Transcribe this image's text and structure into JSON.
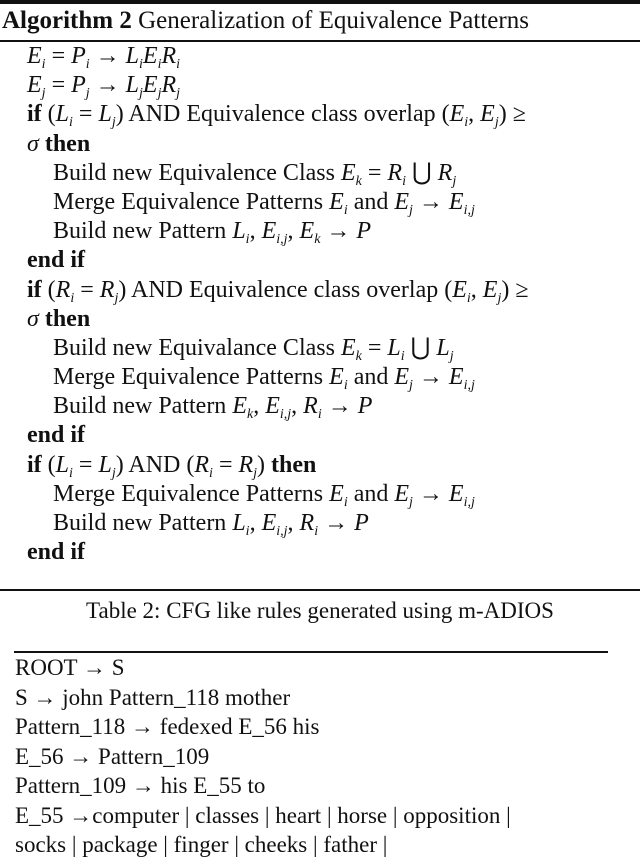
{
  "algorithm": {
    "label": "Algorithm 2",
    "title": "Generalization of Equivalence Patterns",
    "lines": [
      {
        "indent": false,
        "html": "<span class='m'>E<sub>i</sub></span> = <span class='m'>P<sub>i</sub></span> → <span class='m'>L<sub>i</sub>E<sub>i</sub>R<sub>i</sub></span>"
      },
      {
        "indent": false,
        "html": "<span class='m'>E<sub>j</sub></span> = <span class='m'>P<sub>j</sub></span> → <span class='m'>L<sub>j</sub>E<sub>j</sub>R<sub>j</sub></span>"
      },
      {
        "indent": false,
        "html": "<span class='kw'>if</span> (<span class='m'>L<sub>i</sub></span> = <span class='m'>L<sub>j</sub></span>) AND Equivalence class overlap (<span class='m'>E<sub>i</sub></span>, <span class='m'>E<sub>j</sub></span>) ≥"
      },
      {
        "indent": false,
        "html": "<span class='m'>σ</span> <span class='kw'>then</span>"
      },
      {
        "indent": true,
        "html": "Build new Equivalence Class <span class='m'>E<sub>k</sub></span> = <span class='m'>R<sub>i</sub></span> ⋃ <span class='m'>R<sub>j</sub></span>"
      },
      {
        "indent": true,
        "html": "Merge Equivalence Patterns <span class='m'>E<sub>i</sub></span> and <span class='m'>E<sub>j</sub></span> → <span class='m'>E<sub>i,j</sub></span>"
      },
      {
        "indent": true,
        "html": "Build new Pattern <span class='m'>L<sub>i</sub></span>, <span class='m'>E<sub>i,j</sub></span>, <span class='m'>E<sub>k</sub></span> → <span class='m'>P</span>"
      },
      {
        "indent": false,
        "html": "<span class='kw'>end if</span>"
      },
      {
        "indent": false,
        "html": "<span class='kw'>if</span> (<span class='m'>R<sub>i</sub></span> = <span class='m'>R<sub>j</sub></span>) AND Equivalence class overlap (<span class='m'>E<sub>i</sub></span>, <span class='m'>E<sub>j</sub></span>) ≥"
      },
      {
        "indent": false,
        "html": "<span class='m'>σ</span> <span class='kw'>then</span>"
      },
      {
        "indent": true,
        "html": "Build new Equivalance Class <span class='m'>E<sub>k</sub></span> = <span class='m'>L<sub>i</sub></span> ⋃ <span class='m'>L<sub>j</sub></span>"
      },
      {
        "indent": true,
        "html": "Merge Equivalence Patterns <span class='m'>E<sub>i</sub></span> and <span class='m'>E<sub>j</sub></span> → <span class='m'>E<sub>i,j</sub></span>"
      },
      {
        "indent": true,
        "html": "Build new Pattern <span class='m'>E<sub>k</sub></span>, <span class='m'>E<sub>i,j</sub></span>, <span class='m'>R<sub>i</sub></span> → <span class='m'>P</span>"
      },
      {
        "indent": false,
        "html": "<span class='kw'>end if</span>"
      },
      {
        "indent": false,
        "html": "<span class='kw'>if</span> (<span class='m'>L<sub>i</sub></span> = <span class='m'>L<sub>j</sub></span>) AND (<span class='m'>R<sub>i</sub></span> = <span class='m'>R<sub>j</sub></span>) <span class='kw'>then</span>"
      },
      {
        "indent": true,
        "html": "Merge Equivalence Patterns <span class='m'>E<sub>i</sub></span> and <span class='m'>E<sub>j</sub></span> → <span class='m'>E<sub>i,j</sub></span>"
      },
      {
        "indent": true,
        "html": "Build new Pattern <span class='m'>L<sub>i</sub></span>, <span class='m'>E<sub>i,j</sub></span>, <span class='m'>R<sub>i</sub></span> → <span class='m'>P</span>"
      },
      {
        "indent": false,
        "html": "<span class='kw'>end if</span>"
      }
    ]
  },
  "table": {
    "caption": "Table 2: CFG like rules generated using m-ADIOS",
    "rows": [
      "ROOT → S",
      "S → john Pattern_118 mother",
      "Pattern_118 → fedexed E_56 his",
      "E_56 → Pattern_109",
      "Pattern_109 → his E_55 to",
      "E_55 →computer | classes | heart | horse | opposition |",
      "socks | package | finger | cheeks | father |"
    ]
  }
}
